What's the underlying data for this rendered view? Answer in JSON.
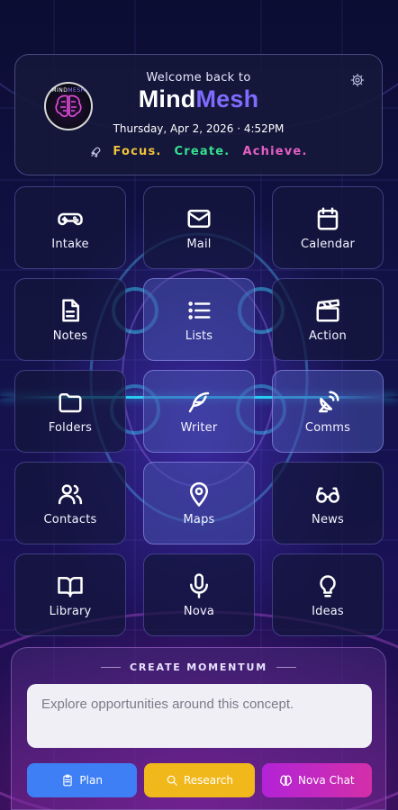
{
  "header": {
    "welcome": "Welcome back to",
    "brand_part1": "Mind",
    "brand_part2": "Mesh",
    "datetime": "Thursday, Apr 2, 2026 · 4:52PM",
    "tagline": [
      "Focus.",
      "Create.",
      "Achieve."
    ],
    "logo_text_a": "MIND",
    "logo_text_b": "MESH",
    "colors": {
      "accent": "#7f6cff",
      "focus": "#f0c23b",
      "create": "#35e08d",
      "achieve": "#e65fc3"
    }
  },
  "tiles": [
    {
      "label": "Intake",
      "icon": "gamepad-icon"
    },
    {
      "label": "Mail",
      "icon": "mail-icon"
    },
    {
      "label": "Calendar",
      "icon": "calendar-icon"
    },
    {
      "label": "Notes",
      "icon": "document-icon"
    },
    {
      "label": "Lists",
      "icon": "list-icon"
    },
    {
      "label": "Action",
      "icon": "clapperboard-icon"
    },
    {
      "label": "Folders",
      "icon": "folder-icon"
    },
    {
      "label": "Writer",
      "icon": "feather-icon"
    },
    {
      "label": "Comms",
      "icon": "satellite-icon"
    },
    {
      "label": "Contacts",
      "icon": "users-icon"
    },
    {
      "label": "Maps",
      "icon": "map-pin-icon"
    },
    {
      "label": "News",
      "icon": "glasses-icon"
    },
    {
      "label": "Library",
      "icon": "book-icon"
    },
    {
      "label": "Nova",
      "icon": "microphone-icon"
    },
    {
      "label": "Ideas",
      "icon": "lightbulb-icon"
    }
  ],
  "momentum": {
    "title": "CREATE MOMENTUM",
    "placeholder": "Explore opportunities around this concept.",
    "buttons": {
      "plan": "Plan",
      "research": "Research",
      "chat": "Nova Chat"
    },
    "colors": {
      "plan": "#3f7ff5",
      "research": "#f1b81c",
      "chat": "#c42ac4"
    }
  }
}
